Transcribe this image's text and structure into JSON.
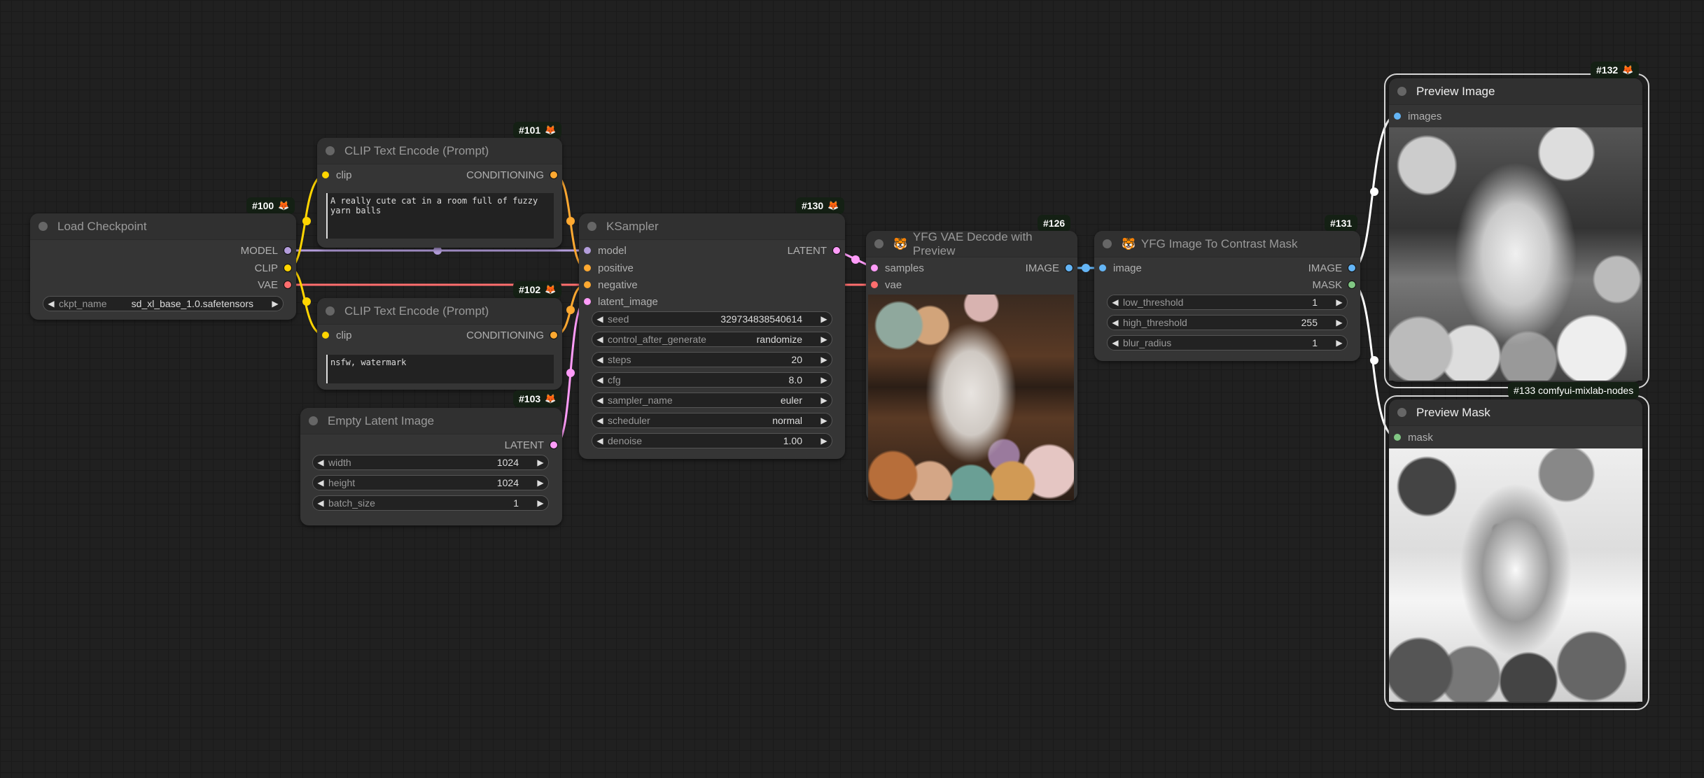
{
  "colors": {
    "model": "#b39ddb",
    "clip": "#ffd500",
    "vae": "#ff6e6e",
    "conditioning": "#ffa931",
    "latent": "#ff9cf9",
    "image": "#64b5f6",
    "mask": "#81c784",
    "selected_link": "#ffffff"
  },
  "nodes": {
    "load_checkpoint": {
      "id_badge": "#100",
      "title": "Load Checkpoint",
      "outputs": [
        "MODEL",
        "CLIP",
        "VAE"
      ],
      "widgets": [
        {
          "label": "ckpt_name",
          "value": "sd_xl_base_1.0.safetensors"
        }
      ]
    },
    "clip_positive": {
      "id_badge": "#101",
      "title": "CLIP Text Encode (Prompt)",
      "inputs": [
        "clip"
      ],
      "outputs": [
        "CONDITIONING"
      ],
      "text": "A really cute cat in a room full of fuzzy yarn balls"
    },
    "clip_negative": {
      "id_badge": "#102",
      "title": "CLIP Text Encode (Prompt)",
      "inputs": [
        "clip"
      ],
      "outputs": [
        "CONDITIONING"
      ],
      "text": "nsfw, watermark"
    },
    "empty_latent": {
      "id_badge": "#103",
      "title": "Empty Latent Image",
      "outputs": [
        "LATENT"
      ],
      "widgets": [
        {
          "label": "width",
          "value": "1024"
        },
        {
          "label": "height",
          "value": "1024"
        },
        {
          "label": "batch_size",
          "value": "1"
        }
      ]
    },
    "ksampler": {
      "id_badge": "#130",
      "title": "KSampler",
      "inputs": [
        "model",
        "positive",
        "negative",
        "latent_image"
      ],
      "outputs": [
        "LATENT"
      ],
      "widgets": [
        {
          "label": "seed",
          "value": "329734838540614"
        },
        {
          "label": "control_after_generate",
          "value": "randomize"
        },
        {
          "label": "steps",
          "value": "20"
        },
        {
          "label": "cfg",
          "value": "8.0"
        },
        {
          "label": "sampler_name",
          "value": "euler"
        },
        {
          "label": "scheduler",
          "value": "normal"
        },
        {
          "label": "denoise",
          "value": "1.00"
        }
      ]
    },
    "vae_decode": {
      "id_badge": "#126",
      "title": "YFG VAE Decode with Preview",
      "title_icon": "tiger-icon",
      "inputs": [
        "samples",
        "vae"
      ],
      "outputs": [
        "IMAGE"
      ],
      "preview": "color photo of a fluffy cat surrounded by yarn balls"
    },
    "contrast_mask": {
      "id_badge": "#131",
      "title": "YFG Image To Contrast Mask",
      "title_icon": "tiger-icon",
      "inputs": [
        "image"
      ],
      "outputs": [
        "IMAGE",
        "MASK"
      ],
      "widgets": [
        {
          "label": "low_threshold",
          "value": "1"
        },
        {
          "label": "high_threshold",
          "value": "255"
        },
        {
          "label": "blur_radius",
          "value": "1"
        }
      ]
    },
    "preview_image": {
      "id_badge": "#132",
      "title": "Preview Image",
      "inputs": [
        "images"
      ],
      "preview": "grayscale cat image"
    },
    "preview_mask": {
      "id_badge": "#133 comfyui-mixlab-nodes",
      "title": "Preview Mask",
      "inputs": [
        "mask"
      ],
      "preview": "contrast mask of cat image"
    }
  },
  "icons": {
    "fox": "🦊",
    "tiger": "🐯",
    "arrow_left": "◀",
    "arrow_right": "▶"
  }
}
